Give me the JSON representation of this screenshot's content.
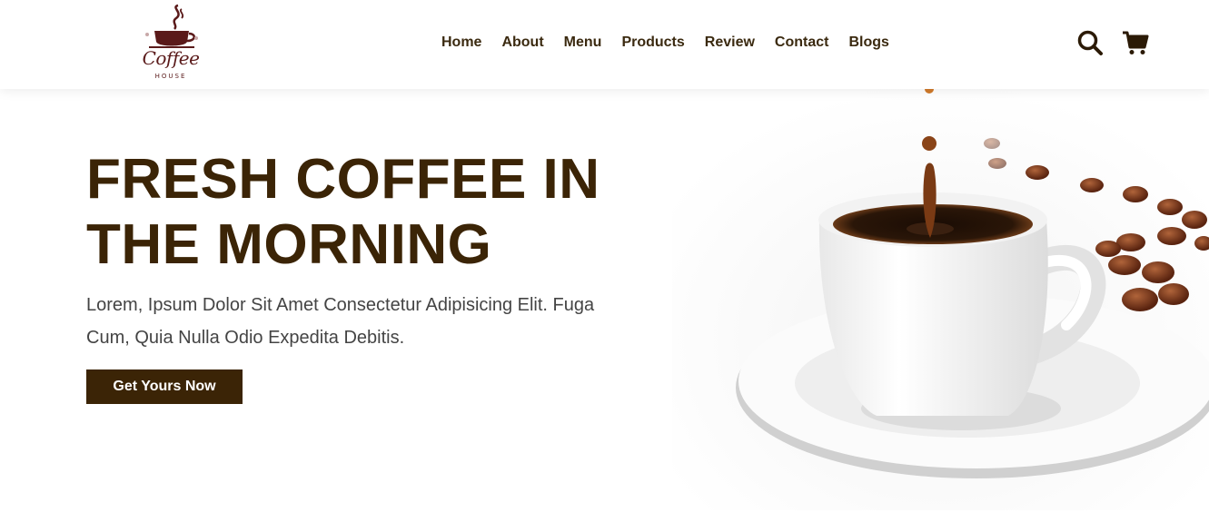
{
  "brand": {
    "logo_text": "Coffee",
    "logo_sub": "HOUSE"
  },
  "nav": {
    "items": [
      {
        "label": "Home"
      },
      {
        "label": "About"
      },
      {
        "label": "Menu"
      },
      {
        "label": "Products"
      },
      {
        "label": "Review"
      },
      {
        "label": "Contact"
      },
      {
        "label": "Blogs"
      }
    ]
  },
  "header_icons": [
    "search-icon",
    "cart-icon"
  ],
  "hero": {
    "title_line1": "FRESH COFFEE IN",
    "title_line2": "THE MORNING",
    "text_line1": "Lorem, Ipsum Dolor Sit Amet Consectetur Adipisicing Elit. Fuga",
    "text_line2": "Cum, Quia Nulla Odio Expedita Debitis.",
    "cta_label": "Get Yours Now"
  },
  "colors": {
    "brand_dark": "#3b2406",
    "logo_red": "#5a1a1a",
    "coffee": "#2a1608",
    "bean": "#7a3a20"
  }
}
